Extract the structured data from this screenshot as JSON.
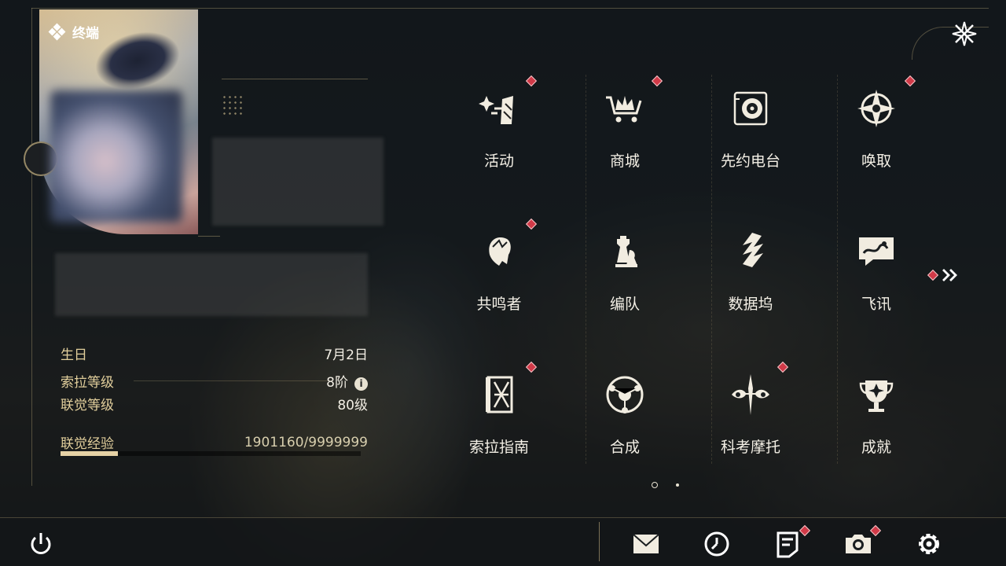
{
  "header": {
    "title": "终端"
  },
  "stats": {
    "birthday": {
      "label": "生日",
      "value": "7月2日"
    },
    "sola_level": {
      "label": "索拉等级",
      "value": "8阶"
    },
    "union_level": {
      "label": "联觉等级",
      "value": "80级"
    },
    "union_exp": {
      "label": "联觉经验",
      "value": "1901160/9999999",
      "progress_fraction": 0.19
    }
  },
  "menu": [
    {
      "label": "活动",
      "icon": "sparkle-slash-icon",
      "badge": true
    },
    {
      "label": "商城",
      "icon": "crown-cart-icon",
      "badge": true
    },
    {
      "label": "先约电台",
      "icon": "radio-disc-icon",
      "badge": false
    },
    {
      "label": "唤取",
      "icon": "compass-star-icon",
      "badge": true
    },
    {
      "label": "共鸣者",
      "icon": "character-head-icon",
      "badge": true
    },
    {
      "label": "编队",
      "icon": "chess-pieces-icon",
      "badge": false
    },
    {
      "label": "数据坞",
      "icon": "data-dock-icon",
      "badge": false
    },
    {
      "label": "飞讯",
      "icon": "chat-bubble-icon",
      "badge": false
    },
    {
      "label": "索拉指南",
      "icon": "guide-book-icon",
      "badge": true
    },
    {
      "label": "合成",
      "icon": "synthesis-orb-icon",
      "badge": false
    },
    {
      "label": "科考摩托",
      "icon": "motorbike-icon",
      "badge": true
    },
    {
      "label": "成就",
      "icon": "trophy-icon",
      "badge": false
    }
  ],
  "pager": {
    "current": 1,
    "total": 2
  },
  "bottom_bar": [
    "power-icon",
    "mail-icon",
    "clock-icon",
    "notice-icon",
    "camera-icon",
    "settings-gear-icon"
  ],
  "colors": {
    "accent_gold": "#e2cf9c",
    "badge_red": "#d13a48",
    "text": "#f4f0e6"
  }
}
